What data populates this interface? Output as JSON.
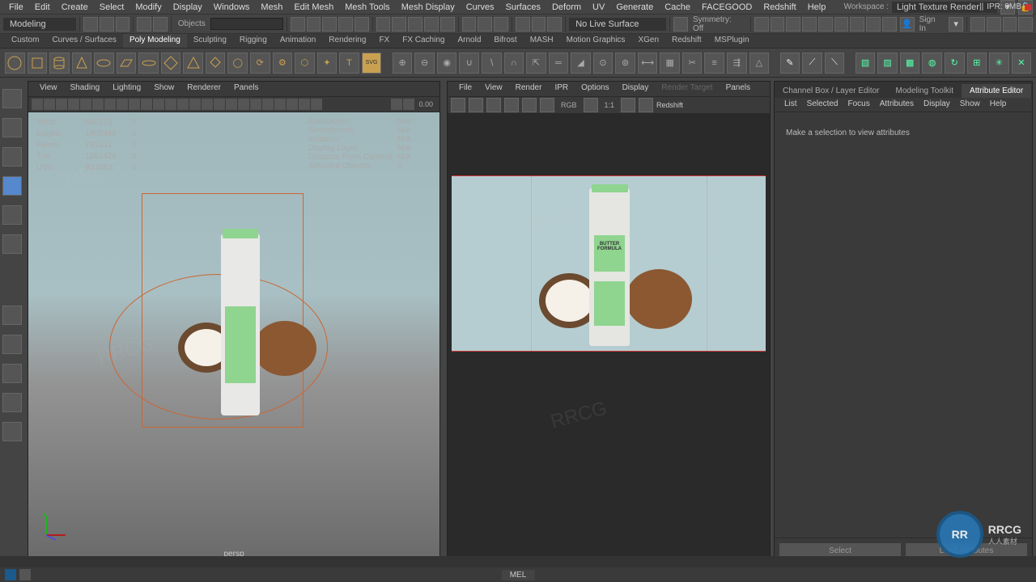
{
  "menubar": {
    "items": [
      "File",
      "Edit",
      "Create",
      "Select",
      "Modify",
      "Display",
      "Windows",
      "Mesh",
      "Edit Mesh",
      "Mesh Tools",
      "Mesh Display",
      "Curves",
      "Surfaces",
      "Deform",
      "UV",
      "Generate",
      "Cache",
      "FACEGOOD",
      "Redshift",
      "Help"
    ],
    "workspace_label": "Workspace :",
    "workspace_value": "Light Texture Render"
  },
  "toolbar": {
    "mode": "Modeling",
    "objects_label": "Objects",
    "live_surface": "No Live Surface",
    "symmetry": "Symmetry: Off",
    "signin": "Sign In"
  },
  "shelftabs": [
    "Custom",
    "Curves / Surfaces",
    "Poly Modeling",
    "Sculpting",
    "Rigging",
    "Animation",
    "Rendering",
    "FX",
    "FX Caching",
    "Arnold",
    "Bifrost",
    "MASH",
    "Motion Graphics",
    "XGen",
    "Redshift",
    "MSPlugin"
  ],
  "shelf_active": "Poly Modeling",
  "viewport": {
    "menus": [
      "View",
      "Shading",
      "Lighting",
      "Show",
      "Renderer",
      "Panels"
    ],
    "hud": {
      "rows": [
        {
          "k": "Verts:",
          "v1": "645173",
          "v2": "0"
        },
        {
          "k": "Edges:",
          "v1": "1405349",
          "v2": "0"
        },
        {
          "k": "Faces:",
          "v1": "763331",
          "v2": "0"
        },
        {
          "k": "Tris:",
          "v1": "1282428",
          "v2": "0"
        },
        {
          "k": "UVs:",
          "v1": "833592",
          "v2": "0"
        }
      ],
      "right": [
        {
          "k": "Backfaces:",
          "v": "N/A"
        },
        {
          "k": "Smoothness:",
          "v": "N/A"
        },
        {
          "k": "Instance:",
          "v": "N/A"
        },
        {
          "k": "Display Layer:",
          "v": "N/A"
        },
        {
          "k": "Distance From Camera:",
          "v": "N/A"
        },
        {
          "k": "Selected Objects:",
          "v": "0"
        }
      ],
      "noanim": "0.00"
    },
    "camera": "persp"
  },
  "renderview": {
    "menus": [
      "File",
      "View",
      "Render",
      "IPR",
      "Options",
      "Display",
      "Render Target",
      "Panels"
    ],
    "rgb": "RGB",
    "ratio": "1:1",
    "engine": "Redshift",
    "ipr": "IPR: 0MB",
    "product_label": "BUTTER FORMULA"
  },
  "rightpanel": {
    "tabs": [
      "Channel Box / Layer Editor",
      "Modeling Toolkit",
      "Attribute Editor"
    ],
    "active": 2,
    "menus": [
      "List",
      "Selected",
      "Focus",
      "Attributes",
      "Display",
      "Show",
      "Help"
    ],
    "message": "Make a selection to view attributes",
    "foot": [
      "Select",
      "Load Attributes"
    ]
  },
  "commandline": {
    "lang": "MEL"
  },
  "logo": {
    "txt": "RRCG",
    "sub": "人人素材"
  }
}
